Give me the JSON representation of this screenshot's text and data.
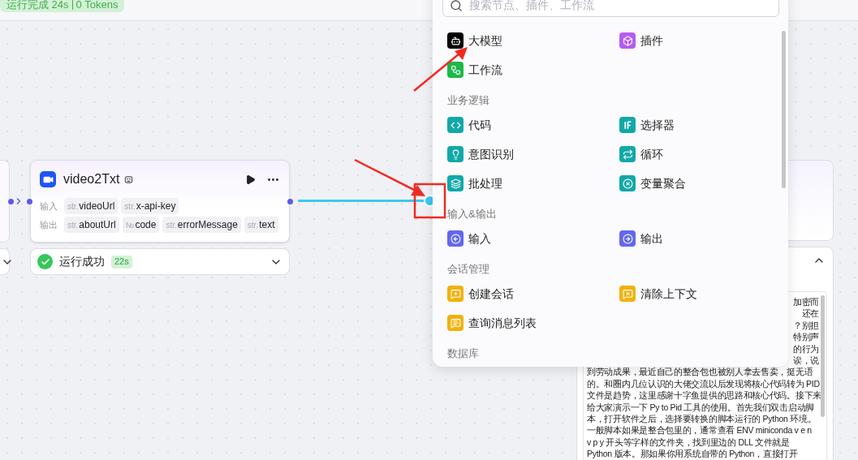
{
  "run_badge": {
    "status": "运行完成 24s",
    "tokens": "0 Tokens"
  },
  "left_node": {
    "status": {
      "expanded": false
    }
  },
  "node": {
    "title": "video2Txt",
    "status": {
      "text": "运行成功",
      "time": "22s",
      "success": true,
      "expanded": false
    },
    "rows": [
      {
        "label": "输入",
        "params": [
          {
            "type": "str.",
            "name": "videoUrl"
          },
          {
            "type": "str.",
            "name": "x-api-key"
          }
        ]
      },
      {
        "label": "输出",
        "params": [
          {
            "type": "str.",
            "name": "aboutUrl"
          },
          {
            "type": "№",
            "name": "code"
          },
          {
            "type": "str.",
            "name": "errorMessage"
          },
          {
            "type": "str.",
            "name": "text"
          }
        ]
      }
    ]
  },
  "add_menu": {
    "search": {
      "placeholder": "搜索节点、插件、工作流"
    },
    "groups": [
      {
        "items": [
          {
            "label": "大模型",
            "color": "#000000"
          },
          {
            "label": "插件",
            "color": "#b45cf2"
          },
          {
            "label": "工作流",
            "color": "#1db84a"
          }
        ]
      },
      {
        "title": "业务逻辑",
        "items": [
          {
            "label": "代码",
            "color": "#13a8a8"
          },
          {
            "label": "选择器",
            "color": "#13a8a8"
          },
          {
            "label": "意图识别",
            "color": "#13a8a8"
          },
          {
            "label": "循环",
            "color": "#13a8a8"
          },
          {
            "label": "批处理",
            "color": "#13a8a8"
          },
          {
            "label": "变量聚合",
            "color": "#13a8a8"
          }
        ]
      },
      {
        "title": "输入&输出",
        "items": [
          {
            "label": "输入",
            "color": "#6466f1"
          },
          {
            "label": "输出",
            "color": "#6466f1"
          }
        ]
      },
      {
        "title": "会话管理",
        "items": [
          {
            "label": "创建会话",
            "color": "#f0b20c"
          },
          {
            "label": "清除上下文",
            "color": "#f0b20c"
          },
          {
            "label": "查询消息列表",
            "color": "#f0b20c"
          }
        ]
      },
      {
        "title": "数据库"
      }
    ]
  },
  "output_panel": {
    "expanded": true,
    "lines": [
      {
        "kind": "clipped",
        "text": "加密而"
      },
      {
        "kind": "clipped",
        "text": "还在"
      },
      {
        "kind": "clipped",
        "text": "？别担"
      },
      {
        "kind": "clipped",
        "text": "特别声"
      },
      {
        "kind": "clipped",
        "text": "的行为"
      },
      {
        "kind": "clipped",
        "text": "诶，说"
      },
      {
        "kind": "full",
        "text": "到劳动成果，最近自己的整合包也被别人拿去售卖，挺无语"
      },
      {
        "kind": "full",
        "text": "的。和圈内几位认识的大佬交流以后发现将核心代码转为 PID"
      },
      {
        "kind": "full",
        "text": "文件是趋势，这里感谢十字鱼提供的思路和核心代码。接下来"
      },
      {
        "kind": "full",
        "text": "给大家演示一下 Py to Pid 工具的使用。首先我们双击启动脚"
      },
      {
        "kind": "full",
        "text": "本，打开软件之后，选择要转换的脚本运行的 Python 环境。"
      },
      {
        "kind": "full",
        "text": "一般脚本如果是整合包里的，通常查看 ENV miniconda v e n"
      },
      {
        "kind": "full",
        "text": "v p y 开头等字样的文件夹，找到里边的 DLL 文件就是"
      },
      {
        "kind": "full",
        "text": "Python 版本。那如果你用系统自带的 Python，直接打开"
      }
    ]
  }
}
